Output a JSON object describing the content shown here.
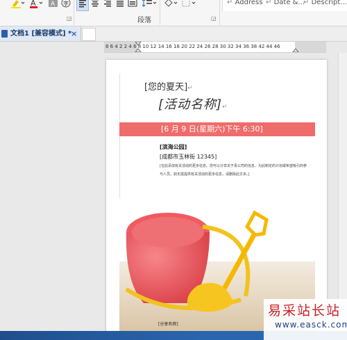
{
  "ribbon": {
    "paragraph_group_label": "段落",
    "styles": [
      "Address",
      "Date &...",
      "Descript..."
    ]
  },
  "tab": {
    "title": "文档1 [兼容模式] *",
    "close": "×"
  },
  "ruler": {
    "ticks": "8  6  4  2     2  4  6  8  10 12 14 16 18 20 22 24 26 28 30 32 34 36 38     42 44 46"
  },
  "document": {
    "summer": "[您的夏天]",
    "activity_name": "[活动名称]",
    "date_line": "[6 月 9 日(星期六)下午 6:30]",
    "venue": "[滨海公园]",
    "address": "[成都市玉林街 12345]",
    "description": "[在此添加有关活动的更多信息。您可以分享关于贵公司的信息、为此制定的计划或希望吸引的参与人员。如无需提供有关活动的更多信息，请删除此文本。]",
    "share": "[分享名称]"
  },
  "watermark": {
    "site_name": "易采站长站",
    "url": "www.easck.com"
  },
  "colors": {
    "accent_band": "#ef6c6c",
    "bucket": "#e9484e",
    "shovel": "#f7c21a"
  }
}
